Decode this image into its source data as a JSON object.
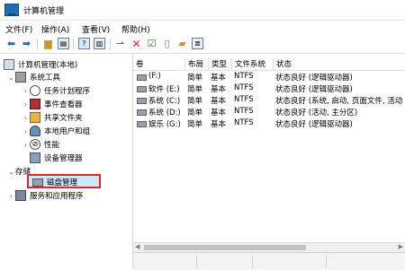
{
  "window": {
    "title": "计算机管理"
  },
  "menu": [
    "文件(F)",
    "操作(A)",
    "查看(V)",
    "帮助(H)"
  ],
  "tree": {
    "root": "计算机管理(本地)",
    "system_tools": "系统工具",
    "task_scheduler": "任务计划程序",
    "event_viewer": "事件查看器",
    "shared_folders": "共享文件夹",
    "local_users": "本地用户和组",
    "performance": "性能",
    "device_manager": "设备管理器",
    "storage": "存储",
    "disk_management": "磁盘管理",
    "services_apps": "服务和应用程序"
  },
  "table": {
    "headers": [
      "卷",
      "布局",
      "类型",
      "文件系统",
      "状态"
    ],
    "rows": [
      {
        "vol": "(F:)",
        "layout": "简单",
        "type": "基本",
        "fs": "NTFS",
        "status": "状态良好 (逻辑驱动器)"
      },
      {
        "vol": "软件 (E:)",
        "layout": "简单",
        "type": "基本",
        "fs": "NTFS",
        "status": "状态良好 (逻辑驱动器)"
      },
      {
        "vol": "系统 (C:)",
        "layout": "简单",
        "type": "基本",
        "fs": "NTFS",
        "status": "状态良好 (系统, 启动, 页面文件, 活动"
      },
      {
        "vol": "系统 (D:)",
        "layout": "简单",
        "type": "基本",
        "fs": "NTFS",
        "status": "状态良好 (活动, 主分区)"
      },
      {
        "vol": "娱乐 (G:)",
        "layout": "简单",
        "type": "基本",
        "fs": "NTFS",
        "status": "状态良好 (逻辑驱动器)"
      }
    ]
  },
  "colors": {
    "accent": "#1b6ec2",
    "highlight_border": "#d9272e",
    "selection": "#cde8ff"
  }
}
